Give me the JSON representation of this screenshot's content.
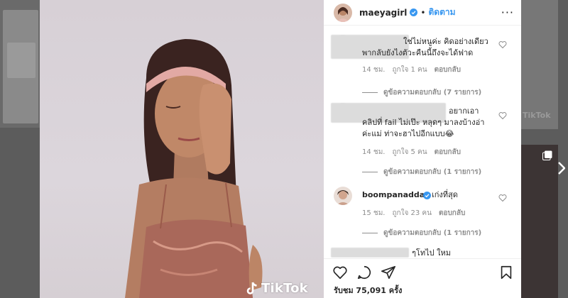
{
  "background": {
    "left_watermark": "TikTok"
  },
  "media": {
    "watermark": "TikTok"
  },
  "post": {
    "username": "maeyagirl",
    "separator": "•",
    "follow_label": "ติดตาม",
    "more_label": "···"
  },
  "comments": [
    {
      "text_line1": "ใช่ไม่หนูค่ะ คิดอย่างเดียว",
      "text_line2": "พากลับยังไงตัวะคืนนี้ถึงจะได้ฟาด",
      "time": "14 ชม.",
      "likes": "ถูกใจ 1 คน",
      "reply": "ตอบกลับ",
      "view_replies": "ดูข้อความตอบกลับ (7 รายการ)"
    },
    {
      "text_line1": "อยากเอา",
      "text_line2": "คลิปที่ fail ไม่เป๊ะ หลุดๆ มาลงบ้างอ่า",
      "text_line3": "ค่ะแม่ ท่าจะฮาไปอีกแบบ😂",
      "time": "14 ชม.",
      "likes": "ถูกใจ 5 คน",
      "reply": "ตอบกลับ",
      "view_replies": "ดูข้อความตอบกลับ (1 รายการ)"
    },
    {
      "username": "boompanadda",
      "text": "เก่งที่สุด",
      "time": "15 ชม.",
      "likes": "ถูกใจ 23 คน",
      "reply": "ตอบกลับ",
      "view_replies": "ดูข้อความตอบกลับ (1 รายการ)"
    },
    {
      "text_line1": "ๆโทไป ใหม"
    }
  ],
  "footer": {
    "views": "รับชม 75,091 ครั้ง"
  },
  "colors": {
    "accent": "#3897f0",
    "verified": "#3897f0",
    "text": "#262626",
    "muted": "#8e8e8e"
  },
  "icons": [
    "heart-icon",
    "comment-icon",
    "share-icon",
    "bookmark-icon",
    "verified-badge-icon",
    "more-options-icon",
    "tiktok-logo-icon",
    "next-arrow-icon",
    "gallery-icon"
  ]
}
